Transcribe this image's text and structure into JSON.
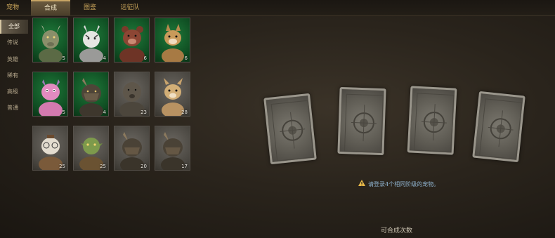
{
  "tabs": [
    {
      "label": "宠物",
      "active": false
    },
    {
      "label": "合成",
      "active": true
    },
    {
      "label": "图鉴",
      "active": false
    },
    {
      "label": "远征队",
      "active": false
    }
  ],
  "categories": [
    {
      "label": "全部",
      "active": true
    },
    {
      "label": "传说",
      "active": false
    },
    {
      "label": "英雄",
      "active": false
    },
    {
      "label": "稀有",
      "active": false
    },
    {
      "label": "高级",
      "active": false
    },
    {
      "label": "普通",
      "active": false
    }
  ],
  "pets": [
    {
      "creature": "goat-beast",
      "rarity": "green",
      "count": "5"
    },
    {
      "creature": "white-tiger",
      "rarity": "green",
      "count": "4"
    },
    {
      "creature": "red-bear",
      "rarity": "green",
      "count": "6"
    },
    {
      "creature": "squirrel",
      "rarity": "green",
      "count": "6"
    },
    {
      "creature": "pink-imp",
      "rarity": "green",
      "count": "5"
    },
    {
      "creature": "armored-boar",
      "rarity": "green",
      "count": "4"
    },
    {
      "creature": "mole",
      "rarity": "grey",
      "count": "23"
    },
    {
      "creature": "fawn",
      "rarity": "grey",
      "count": "28"
    },
    {
      "creature": "scholar-owl",
      "rarity": "grey",
      "count": "25"
    },
    {
      "creature": "goblin",
      "rarity": "grey",
      "count": "25"
    },
    {
      "creature": "armored-boar",
      "rarity": "grey",
      "count": "20"
    },
    {
      "creature": "armored-boar",
      "rarity": "grey",
      "count": "17"
    }
  ],
  "cards": [
    "card-back",
    "card-back",
    "card-back",
    "card-back"
  ],
  "notice": {
    "icon": "warning-icon",
    "text": "请登录4个相同阶级的宠物。"
  },
  "craft_count_label": "可合成次数",
  "colors": {
    "accent": "#c7a564",
    "green_slot": "#1f7a3a",
    "grey_slot": "#4a4741",
    "notice": "#8fb3cf"
  }
}
